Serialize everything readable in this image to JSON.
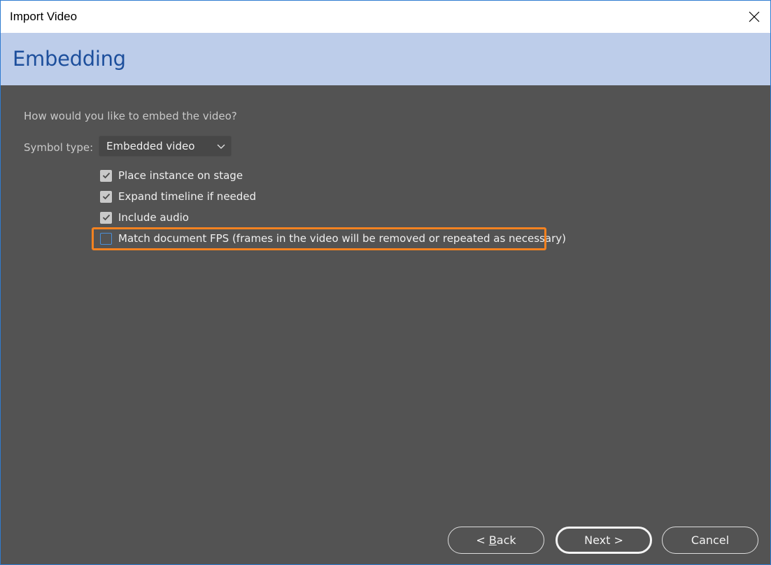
{
  "window": {
    "title": "Import Video",
    "close_icon": "close-icon"
  },
  "header": {
    "title": "Embedding"
  },
  "form": {
    "question": "How would you like to embed the video?",
    "symbol_type": {
      "label": "Symbol type:",
      "selected": "Embedded video"
    },
    "options": [
      {
        "label": "Place instance on stage",
        "checked": true
      },
      {
        "label": "Expand timeline if needed",
        "checked": true
      },
      {
        "label": "Include audio",
        "checked": true
      },
      {
        "label": "Match document FPS (frames in the video will be removed or repeated as necessary)",
        "checked": false,
        "highlighted": true
      }
    ]
  },
  "buttons": {
    "back_prefix": "< ",
    "back_mnemonic": "B",
    "back_rest": "ack",
    "next": "Next >",
    "cancel": "Cancel"
  },
  "colors": {
    "header_band": "#bdcdea",
    "header_title": "#1d4f9c",
    "content_bg": "#535353",
    "highlight": "#f58220",
    "window_border": "#2f7bd0"
  }
}
